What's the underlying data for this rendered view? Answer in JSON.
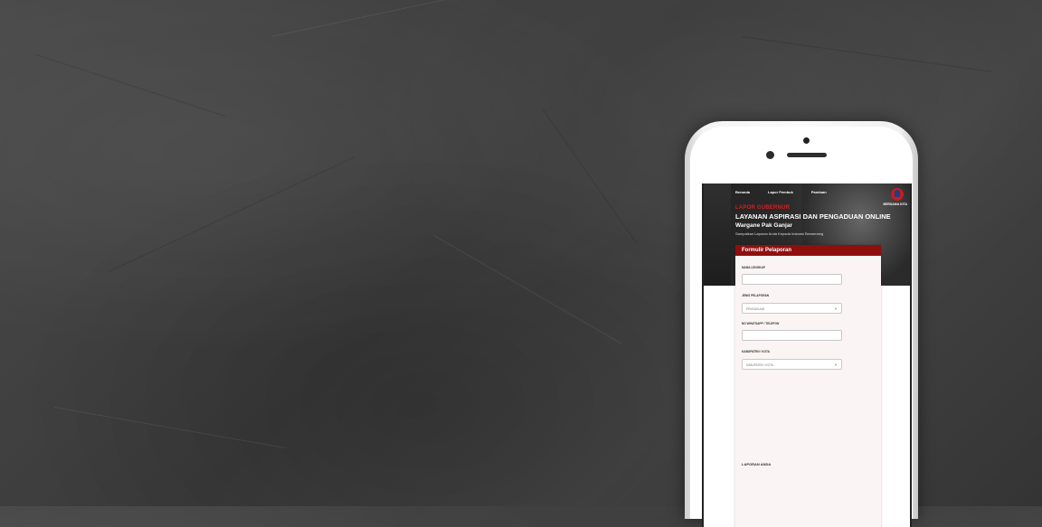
{
  "nav": [
    "Beranda",
    "Lapor Pembuk",
    "Panduan"
  ],
  "logo_caption": "BERSAMA KITA",
  "hero": {
    "kicker": "LAPOR GUBERNUR",
    "title": "LAYANAN ASPIRASI DAN PENGADUAN ONLINE",
    "subtitle": "Wargane Pak Ganjar",
    "description": "Sampaikan Laporan Anda Kepada Instansi Berwenang"
  },
  "form": {
    "heading": "Formulir Pelaporan",
    "name_label": "NAMA LENGKAP",
    "type_label": "JENIS PELAPORAN",
    "type_value": "PENGADUAN",
    "phone_label": "NO WHATSAPP / TELEPON",
    "region_label": "KABUPATEN / KOTA",
    "region_value": "KABUPATEN / KOTA",
    "report_label": "LAPORAN ANDA"
  },
  "icons": {
    "select_chevron": "chevron-down-icon",
    "logo": "logo-icon"
  },
  "colors": {
    "accent": "#8f0f0f",
    "kicker": "#d12121"
  }
}
